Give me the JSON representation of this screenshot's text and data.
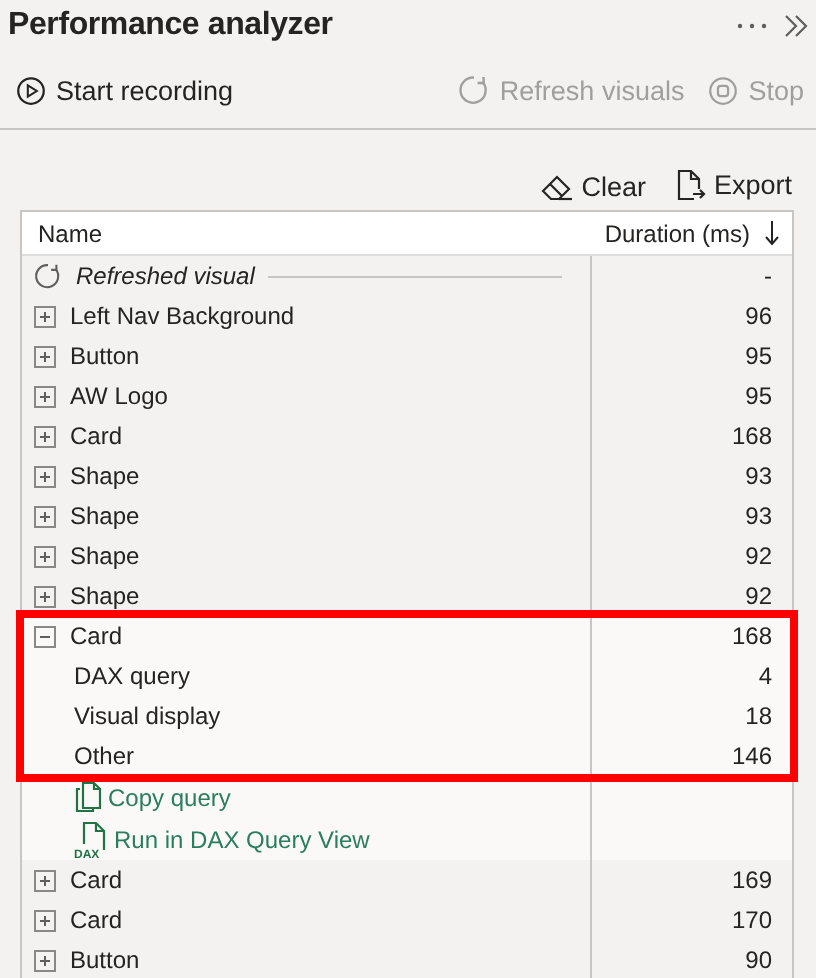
{
  "panel": {
    "title": "Performance analyzer"
  },
  "toolbar": [
    {
      "label": "Start recording",
      "kind": "play",
      "disabled": false
    },
    {
      "label": "Refresh visuals",
      "kind": "refresh",
      "disabled": true
    },
    {
      "label": "Stop",
      "kind": "stop",
      "disabled": true
    }
  ],
  "actions": [
    {
      "label": "Clear",
      "kind": "eraser"
    },
    {
      "label": "Export",
      "kind": "export"
    }
  ],
  "table": {
    "columns": [
      "Name",
      "Duration (ms)"
    ],
    "rows": [
      {
        "kind": "marker",
        "name": "Refreshed visual",
        "duration": "-"
      },
      {
        "kind": "visual",
        "name": "Left Nav Background",
        "duration": "96",
        "expanded": false,
        "highlighted": false
      },
      {
        "kind": "visual",
        "name": "Button",
        "duration": "95",
        "expanded": false,
        "highlighted": false
      },
      {
        "kind": "visual",
        "name": "AW Logo",
        "duration": "95",
        "expanded": false,
        "highlighted": false
      },
      {
        "kind": "visual",
        "name": "Card",
        "duration": "168",
        "expanded": false,
        "highlighted": false
      },
      {
        "kind": "visual",
        "name": "Shape",
        "duration": "93",
        "expanded": false,
        "highlighted": false
      },
      {
        "kind": "visual",
        "name": "Shape",
        "duration": "93",
        "expanded": false,
        "highlighted": false
      },
      {
        "kind": "visual",
        "name": "Shape",
        "duration": "92",
        "expanded": false,
        "highlighted": false
      },
      {
        "kind": "visual",
        "name": "Shape",
        "duration": "92",
        "expanded": false,
        "highlighted": false
      },
      {
        "kind": "visual",
        "name": "Card",
        "duration": "168",
        "expanded": true,
        "highlighted": true,
        "children": [
          {
            "name": "DAX query",
            "duration": "4"
          },
          {
            "name": "Visual display",
            "duration": "18"
          },
          {
            "name": "Other",
            "duration": "146"
          }
        ],
        "links": [
          {
            "label": "Copy query",
            "kind": "copy"
          },
          {
            "label": "Run in DAX Query View",
            "kind": "dax",
            "icon_text": "DAX"
          }
        ]
      },
      {
        "kind": "visual",
        "name": "Card",
        "duration": "169",
        "expanded": false,
        "highlighted": false
      },
      {
        "kind": "visual",
        "name": "Card",
        "duration": "170",
        "expanded": false,
        "highlighted": false
      },
      {
        "kind": "visual",
        "name": "Button",
        "duration": "90",
        "expanded": false,
        "highlighted": false
      }
    ]
  }
}
